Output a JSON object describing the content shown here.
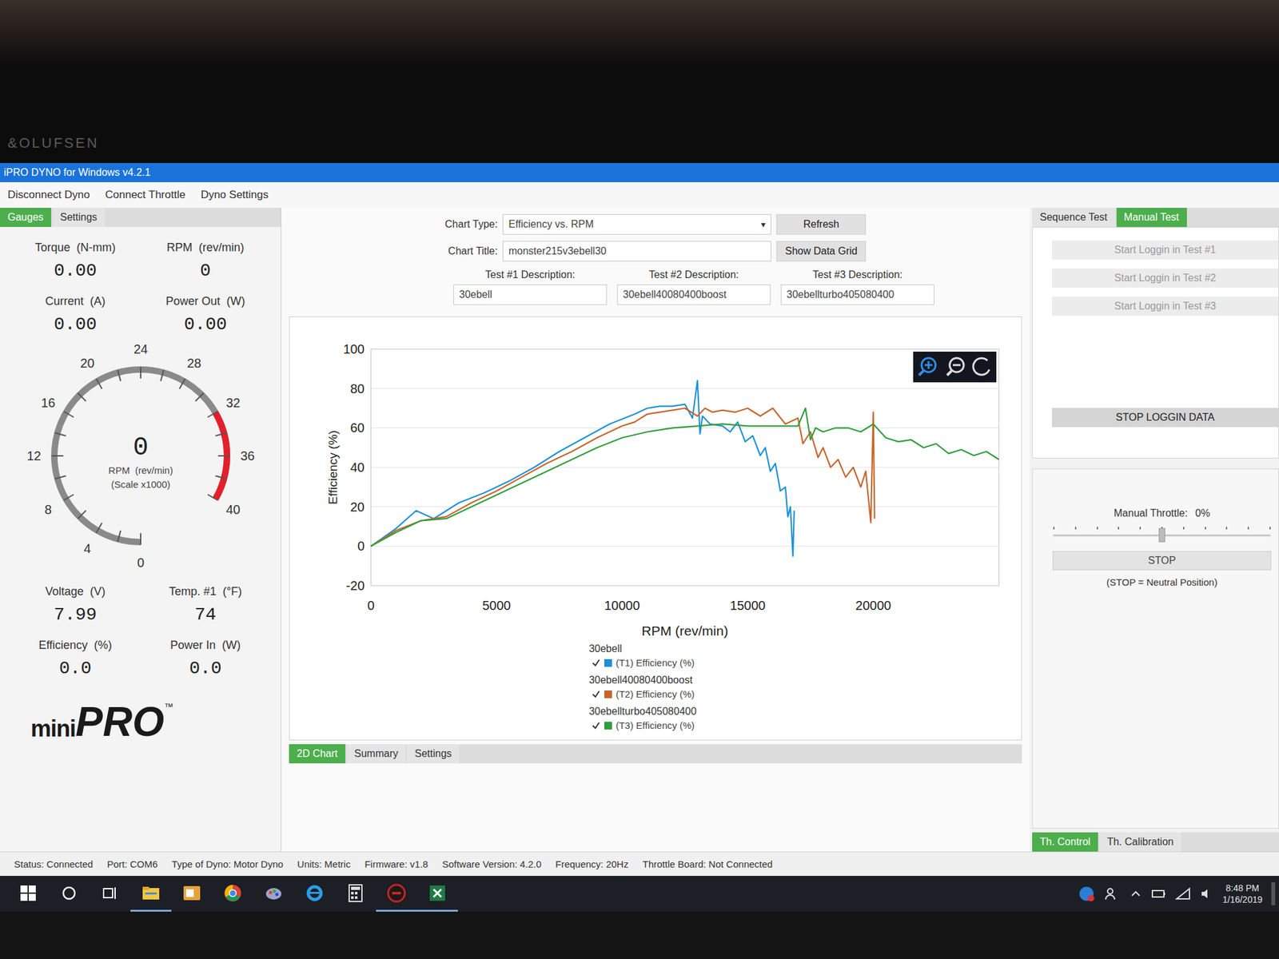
{
  "bezel": {
    "brand": "&OLUFSEN"
  },
  "window": {
    "title": "iPRO DYNO for Windows v4.2.1"
  },
  "menu": [
    "Disconnect Dyno",
    "Connect Throttle",
    "Dyno Settings"
  ],
  "left_tabs": [
    {
      "label": "Gauges",
      "selected": true
    },
    {
      "label": "Settings",
      "selected": false
    }
  ],
  "readouts_top": [
    {
      "label": "Torque  (N-mm)",
      "value": "0.00"
    },
    {
      "label": "RPM  (rev/min)",
      "value": "0"
    },
    {
      "label": "Current  (A)",
      "value": "0.00"
    },
    {
      "label": "Power Out  (W)",
      "value": "0.00"
    }
  ],
  "dial": {
    "ticks": [
      "0",
      "4",
      "8",
      "12",
      "16",
      "20",
      "24",
      "28",
      "32",
      "36",
      "40"
    ],
    "value": "0",
    "caption": "RPM  (rev/min)",
    "scale": "(Scale x1000)",
    "red_from": 32,
    "red_to": 40
  },
  "readouts_bottom": [
    {
      "label": "Voltage  (V)",
      "value": "7.99"
    },
    {
      "label": "Temp. #1  (°F)",
      "value": "74"
    },
    {
      "label": "Efficiency  (%)",
      "value": "0.0"
    },
    {
      "label": "Power In  (W)",
      "value": "0.0"
    }
  ],
  "logo": {
    "small": "mini",
    "big": "PRO",
    "mark": "™"
  },
  "chart_controls": {
    "chart_type_label": "Chart Type:",
    "chart_type": "Efficiency vs. RPM",
    "dropdown_glyph": "▾",
    "refresh": "Refresh",
    "chart_title_label": "Chart Title:",
    "chart_title": "monster215v3ebell30",
    "show_data_grid": "Show Data Grid",
    "tests": [
      {
        "label": "Test #1 Description:",
        "value": "30ebell"
      },
      {
        "label": "Test #2 Description:",
        "value": "30ebell40080400boost"
      },
      {
        "label": "Test #3 Description:",
        "value": "30ebellturbo405080400"
      }
    ]
  },
  "chart": {
    "y_label": "Efficiency (%)",
    "x_label": "RPM (rev/min)",
    "y_ticks": [
      "100",
      "80",
      "60",
      "40",
      "20",
      "0",
      "-20"
    ],
    "x_ticks": [
      "0",
      "5000",
      "10000",
      "15000",
      "20000"
    ],
    "x_max": 25000,
    "series": [
      {
        "name": "30ebell",
        "legend": "(T1) Efficiency (%)",
        "checked": true,
        "color": "#1e90d8",
        "rpm": [
          0,
          1000,
          1800,
          2500,
          3500,
          4500,
          5500,
          6500,
          7500,
          8500,
          9500,
          10500,
          11000,
          11500,
          12000,
          12500,
          12800,
          13000,
          13100,
          13200,
          13500,
          14000,
          14300,
          14600,
          14900,
          15200,
          15500,
          15700,
          15900,
          16100,
          16300,
          16500,
          16600,
          16700,
          16800,
          16850
        ],
        "values": [
          0,
          9,
          18,
          14,
          22,
          27,
          33,
          40,
          48,
          55,
          62,
          67,
          70,
          71,
          71,
          72,
          65,
          84,
          57,
          66,
          62,
          61,
          58,
          63,
          53,
          56,
          46,
          50,
          38,
          42,
          28,
          30,
          15,
          20,
          -5,
          18
        ]
      },
      {
        "name": "30ebell40080400boost",
        "legend": "(T2) Efficiency (%)",
        "checked": true,
        "color": "#c8642a",
        "rpm": [
          0,
          1000,
          2000,
          3000,
          4000,
          5000,
          6000,
          7000,
          8000,
          9000,
          10000,
          10500,
          11000,
          12000,
          12500,
          13000,
          13300,
          13600,
          14000,
          14500,
          15000,
          15500,
          16000,
          16500,
          17000,
          17200,
          17500,
          17800,
          18000,
          18300,
          18600,
          18900,
          19200,
          19500,
          19700,
          19900,
          20000,
          20050
        ],
        "values": [
          0,
          8,
          13,
          15,
          22,
          28,
          35,
          42,
          48,
          55,
          61,
          63,
          67,
          69,
          70,
          66,
          70,
          68,
          69,
          68,
          70,
          66,
          70,
          62,
          65,
          52,
          58,
          45,
          50,
          40,
          44,
          35,
          40,
          30,
          38,
          12,
          68,
          14
        ]
      },
      {
        "name": "30ebellturbo405080400",
        "legend": "(T3) Efficiency (%)",
        "checked": true,
        "color": "#2f9e3c",
        "rpm": [
          0,
          1000,
          2000,
          3000,
          4000,
          5000,
          6000,
          7000,
          8000,
          9000,
          10000,
          11000,
          12000,
          13000,
          14000,
          15000,
          16000,
          17000,
          17300,
          17500,
          17700,
          18000,
          18500,
          19000,
          19500,
          20000,
          20500,
          21000,
          21500,
          22000,
          22500,
          23000,
          23500,
          24000,
          24500,
          25000
        ],
        "values": [
          0,
          7,
          13,
          14,
          20,
          26,
          32,
          38,
          44,
          50,
          55,
          58,
          60,
          61,
          62,
          61,
          61,
          61,
          70,
          54,
          60,
          58,
          60,
          60,
          58,
          62,
          55,
          53,
          54,
          50,
          52,
          47,
          49,
          46,
          48,
          44
        ]
      }
    ]
  },
  "chart_tabs": [
    {
      "label": "2D Chart",
      "selected": true
    },
    {
      "label": "Summary",
      "selected": false
    },
    {
      "label": "Settings",
      "selected": false
    }
  ],
  "right_tabs": [
    {
      "label": "Sequence Test",
      "selected": false
    },
    {
      "label": "Manual Test",
      "selected": true
    }
  ],
  "log_buttons": [
    {
      "label": "Start Loggin in Test #1",
      "disabled": true
    },
    {
      "label": "Start Loggin in Test #2",
      "disabled": true
    },
    {
      "label": "Start Loggin in Test #3",
      "disabled": true
    }
  ],
  "stop_logging": "STOP LOGGIN DATA",
  "throttle": {
    "label": "Manual Throttle:",
    "reading": "0%",
    "level": 0.5,
    "stop": "STOP",
    "note": "(STOP = Neutral Position)"
  },
  "throttle_tabs": [
    {
      "label": "Th. Control",
      "selected": true
    },
    {
      "label": "Th. Calibration",
      "selected": false
    }
  ],
  "status_bar": [
    "Status: Connected",
    "Port: COM6",
    "Type of Dyno: Motor Dyno",
    "Units: Metric",
    "Firmware: v1.8",
    "Software Version: 4.2.0",
    "Frequency: 20Hz",
    "Throttle Board: Not Connected"
  ],
  "taskbar": {
    "apps": [
      {
        "kind": "start",
        "running": false
      },
      {
        "kind": "search",
        "running": false
      },
      {
        "kind": "taskview",
        "running": false
      },
      {
        "kind": "explorer",
        "running": true
      },
      {
        "kind": "outlook",
        "running": false
      },
      {
        "kind": "chrome",
        "running": false
      },
      {
        "kind": "paint",
        "running": false
      },
      {
        "kind": "ie",
        "running": false
      },
      {
        "kind": "calculator",
        "running": false
      },
      {
        "kind": "dyno",
        "running": true
      },
      {
        "kind": "excel",
        "running": true
      }
    ],
    "time": "8:48 PM",
    "date": "1/16/2019"
  }
}
